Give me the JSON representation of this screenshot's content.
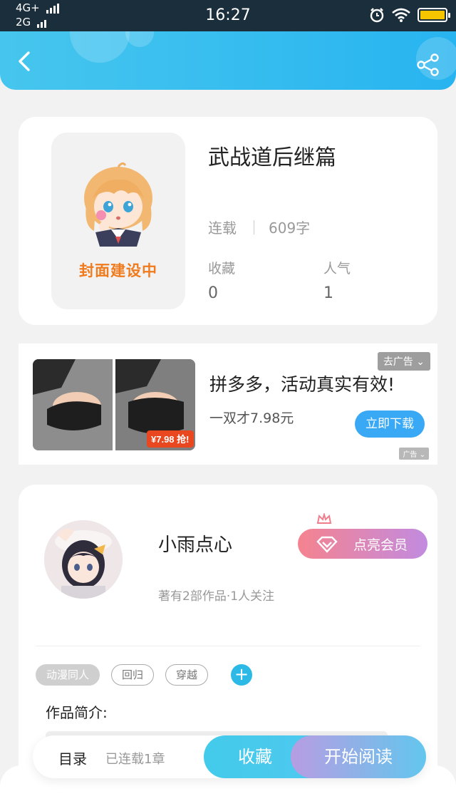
{
  "status_bar": {
    "network1": "4G+",
    "network2": "2G",
    "time": "16:27"
  },
  "header": {
    "back_icon": "chevron-left-icon",
    "share_icon": "share-icon"
  },
  "book": {
    "title": "武战道后继篇",
    "cover_text": "封面建设中",
    "status": "连载",
    "word_count": "609字",
    "fav_label": "收藏",
    "fav_value": "0",
    "pop_label": "人气",
    "pop_value": "1"
  },
  "ad": {
    "close_label": "去广告",
    "title": "拼多多，活动真实有效!",
    "desc": "一双才7.98元",
    "button": "立即下载",
    "price_tag": "¥7.98 抢!",
    "mark": "广告"
  },
  "author": {
    "name": "小雨点心",
    "works": "著有2部作品·1人关注",
    "vip_button": "点亮会员"
  },
  "tags": [
    "动漫同人",
    "回归",
    "穿越"
  ],
  "intro_label": "作品简介:",
  "bottom": {
    "toc": "目录",
    "serial": "已连载1章",
    "fav_button": "收藏",
    "read_button": "开始阅读"
  },
  "colors": {
    "header_accent": "#28b4f0",
    "cover_text": "#f07b1e",
    "ad_button": "#3aa9f5",
    "add_tag": "#2db9e6"
  }
}
